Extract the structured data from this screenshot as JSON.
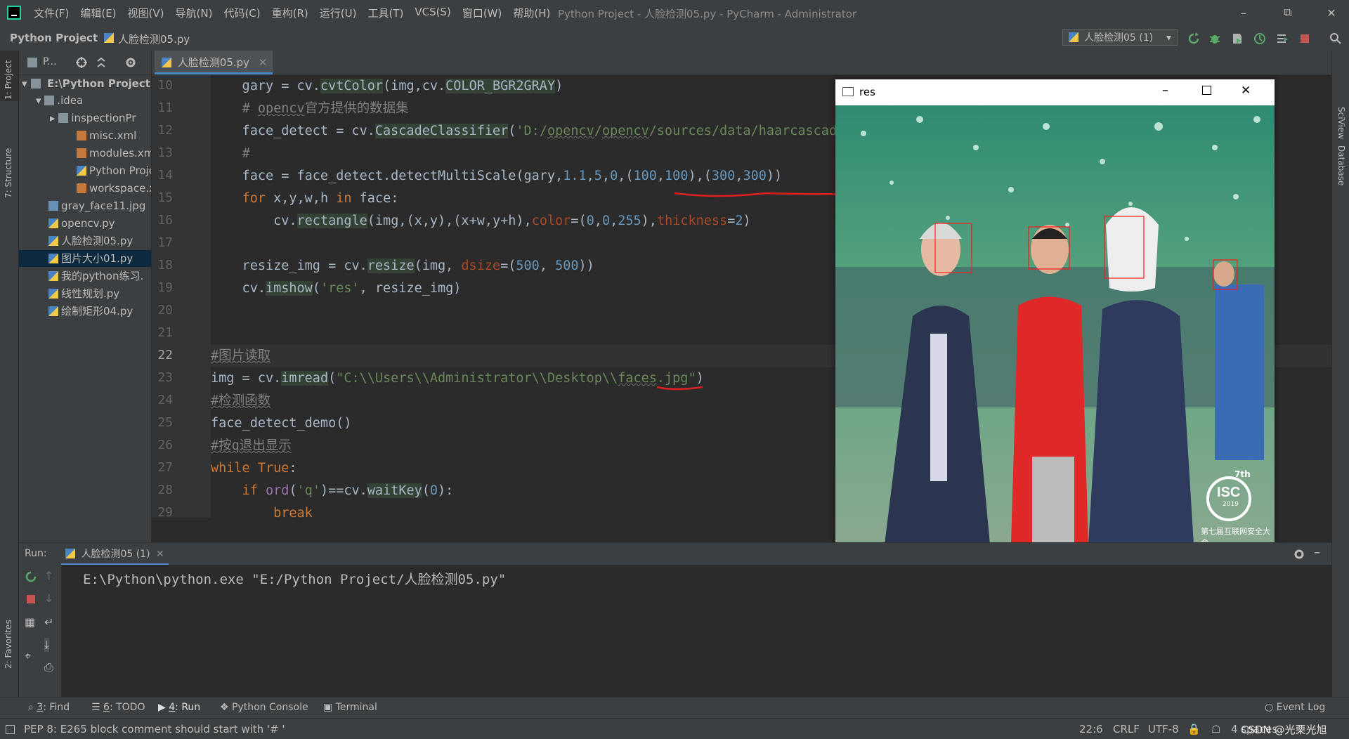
{
  "menu": [
    "文件(F)",
    "编辑(E)",
    "视图(V)",
    "导航(N)",
    "代码(C)",
    "重构(R)",
    "运行(U)",
    "工具(T)",
    "VCS(S)",
    "窗口(W)",
    "帮助(H)"
  ],
  "window_title": "Python Project - 人脸检测05.py - PyCharm - Administrator",
  "breadcrumb": {
    "project": "Python Project",
    "file": "人脸检测05.py"
  },
  "run_config": "人脸检测05 (1)",
  "left_stripe": {
    "project": "1: Project",
    "structure": "7: Structure",
    "favorites": "2: Favorites"
  },
  "right_stripe": {
    "sciview": "SciView",
    "database": "Database"
  },
  "project_panel": {
    "header": "P...",
    "root": "E:\\Python Project",
    "items": [
      {
        "label": ".idea",
        "type": "folder"
      },
      {
        "label": "inspectionPr",
        "type": "folder"
      },
      {
        "label": "misc.xml",
        "type": "xml"
      },
      {
        "label": "modules.xml",
        "type": "xml"
      },
      {
        "label": "Python Proje",
        "type": "python"
      },
      {
        "label": "workspace.xr",
        "type": "xml"
      },
      {
        "label": "gray_face11.jpg",
        "type": "image"
      },
      {
        "label": "opencv.py",
        "type": "python"
      },
      {
        "label": "人脸检测05.py",
        "type": "python"
      },
      {
        "label": "图片大小01.py",
        "type": "python"
      },
      {
        "label": "我的python练习.",
        "type": "python"
      },
      {
        "label": "线性规划.py",
        "type": "python"
      },
      {
        "label": "绘制矩形04.py",
        "type": "python"
      }
    ]
  },
  "editor_tab": "人脸检测05.py",
  "line_numbers": [
    "10",
    "11",
    "12",
    "13",
    "14",
    "15",
    "16",
    "17",
    "18",
    "19",
    "20",
    "21",
    "22",
    "23",
    "24",
    "25",
    "26",
    "27",
    "28",
    "29"
  ],
  "res_window": {
    "title": "res",
    "badge_top": "7th",
    "badge_main": "ISC",
    "badge_year": "2019",
    "caption": "第七届互联网安全大会"
  },
  "run_panel": {
    "label": "Run:",
    "tab": "人脸检测05 (1)",
    "command": "E:\\Python\\python.exe \"E:/Python Project/人脸检测05.py\""
  },
  "bottom_tabs": [
    {
      "num": "3",
      "label": ": Find"
    },
    {
      "num": "6",
      "label": ": TODO"
    },
    {
      "num": "4",
      "label": ": Run"
    },
    {
      "num": "",
      "label": "Python Console"
    },
    {
      "num": "",
      "label": "Terminal"
    }
  ],
  "event_log": "Event Log",
  "status": {
    "message": "PEP 8: E265 block comment should start with '# '",
    "position": "22:6",
    "line_sep": "CRLF",
    "encoding": "UTF-8",
    "indent": "4 spaces",
    "watermark": "CSDN @光栗光旭"
  },
  "colors": {
    "accent": "#4a88c7",
    "annotation": "#e02020",
    "selection": "#0d293e"
  }
}
